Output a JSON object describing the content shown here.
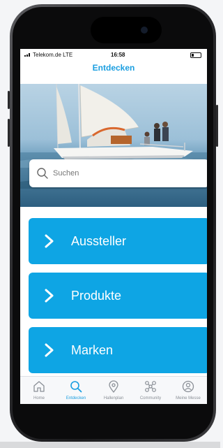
{
  "status": {
    "carrier": "Telekom.de  LTE",
    "time": "16:58"
  },
  "header": {
    "title": "Entdecken"
  },
  "search": {
    "placeholder": "Suchen"
  },
  "tiles": [
    {
      "label": "Aussteller"
    },
    {
      "label": "Produkte"
    },
    {
      "label": "Marken"
    }
  ],
  "tabs": [
    {
      "label": "Home",
      "icon": "home-icon"
    },
    {
      "label": "Entdecken",
      "icon": "search-icon"
    },
    {
      "label": "Hallenplan",
      "icon": "location-pin-icon"
    },
    {
      "label": "Community",
      "icon": "community-icon"
    },
    {
      "label": "Meine Messe",
      "icon": "profile-icon"
    }
  ],
  "colors": {
    "accent": "#0ea5e4",
    "title": "#1a9ee0",
    "tab_inactive": "#8a8f96"
  }
}
